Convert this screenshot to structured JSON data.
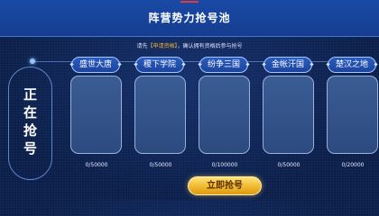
{
  "header": {
    "title": "阵营势力抢号池"
  },
  "notice": {
    "prefix": "请先",
    "highlight": "【申请资格】",
    "suffix": "，确认拥有资格后参与抢号"
  },
  "status_panel": {
    "text": "正在抢号"
  },
  "factions": [
    {
      "name": "盛世大唐",
      "count": "0/50000"
    },
    {
      "name": "稷下学院",
      "count": "0/50000"
    },
    {
      "name": "纷争三国",
      "count": "0/100000"
    },
    {
      "name": "金帐汗国",
      "count": "0/50000"
    },
    {
      "name": "楚汉之地",
      "count": "0/20000"
    }
  ],
  "button": {
    "label": "立即抢号"
  },
  "colors": {
    "background": "#0b1f4a",
    "header": "#1a4aa6",
    "accent_gold": "#f2b233",
    "tab_border": "#9fc9ff"
  }
}
